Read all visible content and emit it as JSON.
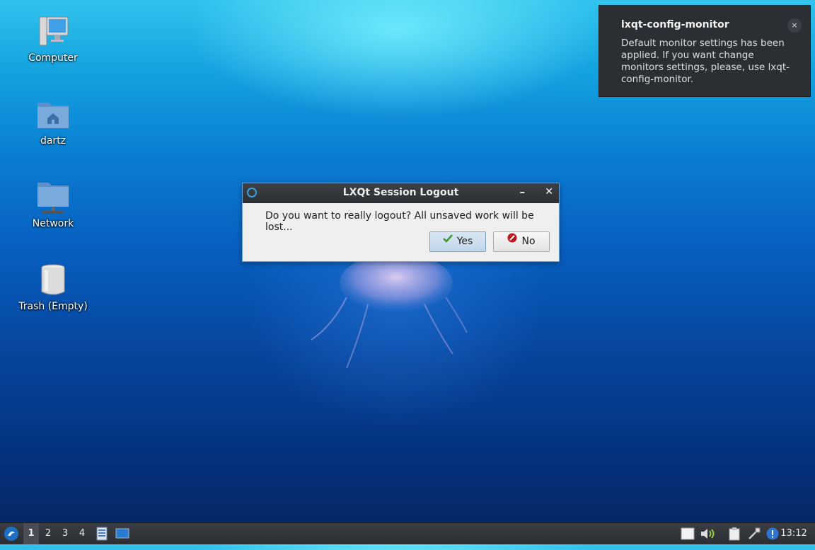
{
  "desktop": {
    "icons": [
      {
        "label": "Computer",
        "icon": "computer-icon"
      },
      {
        "label": "dartz",
        "icon": "home-folder-icon"
      },
      {
        "label": "Network",
        "icon": "network-folder-icon"
      },
      {
        "label": "Trash (Empty)",
        "icon": "trash-icon"
      }
    ]
  },
  "notification": {
    "title": "lxqt-config-monitor",
    "body": "Default monitor settings has been applied. If you want change monitors settings, please, use lxqt-config-monitor.",
    "close": "×"
  },
  "dialog": {
    "title": "LXQt Session Logout",
    "minimize": "–",
    "close": "✕",
    "message": "Do you want to really logout? All unsaved work will be lost...",
    "yes_label": "Yes",
    "no_label": "No"
  },
  "taskbar": {
    "desktops": [
      "1",
      "2",
      "3",
      "4"
    ],
    "active_desktop": "1",
    "clock": "13:12",
    "tray_icons": [
      "notes-icon",
      "volume-icon",
      "clipboard-icon",
      "network-tool-icon",
      "info-icon"
    ]
  },
  "colors": {
    "taskbar_bg": "#2b2e32",
    "dialog_accent": "#6aa0d8",
    "notification_bg": "#2b2e33"
  }
}
